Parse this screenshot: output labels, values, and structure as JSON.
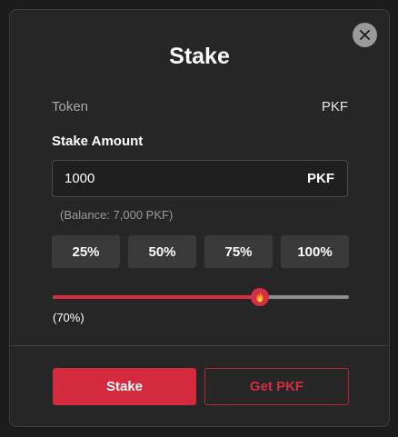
{
  "modal": {
    "title": "Stake",
    "close_icon": "close-icon"
  },
  "token": {
    "label": "Token",
    "value": "PKF"
  },
  "stake_amount": {
    "label": "Stake Amount",
    "value": "1000",
    "unit": "PKF",
    "balance_text": "(Balance: 7,000 PKF)"
  },
  "percent_buttons": [
    "25%",
    "50%",
    "75%",
    "100%"
  ],
  "slider": {
    "value_percent": 70,
    "label": "(70%)",
    "thumb_icon": "fire-icon"
  },
  "actions": {
    "stake_label": "Stake",
    "get_label": "Get PKF"
  },
  "colors": {
    "accent": "#d32a3e",
    "background": "#262626",
    "button_gray": "#3a3a3a"
  }
}
